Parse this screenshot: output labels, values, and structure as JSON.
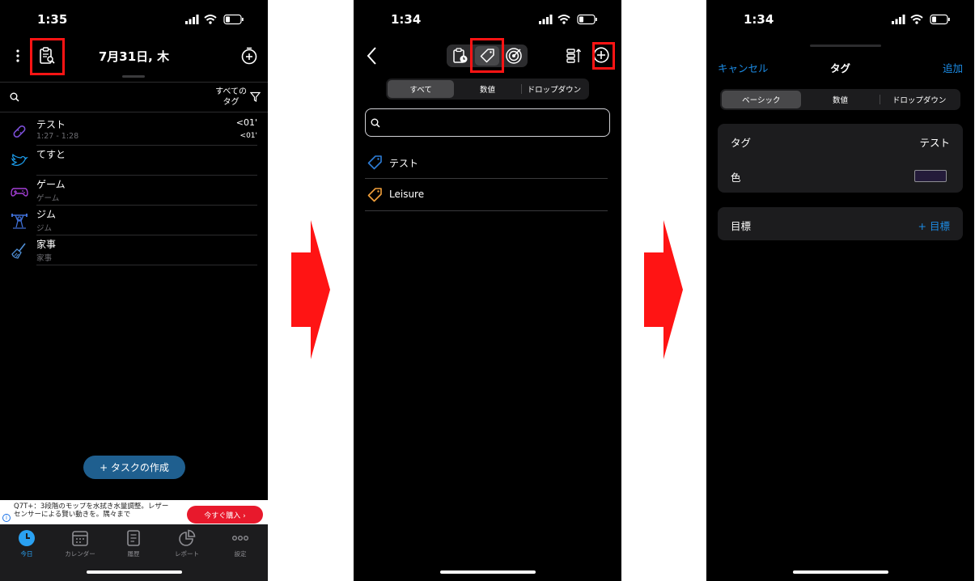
{
  "colors": {
    "arrow": "#ff1414",
    "highlight": "#ff1414",
    "accent_blue": "#1c8ce6",
    "tab_active": "#2aa1f2",
    "tag_test": "#2e7dd7",
    "tag_leisure": "#f2a03b",
    "tag_swatch": "#241b3a",
    "create_button": "#1f5f8f",
    "ad_button": "#e8192c"
  },
  "screen1": {
    "status_time": "1:35",
    "date_title": "7月31日, 木",
    "filter_label_line1": "すべての",
    "filter_label_line2": "タグ",
    "tasks": [
      {
        "name": "テスト",
        "sub": "1:27 - 1:28",
        "duration": "<01'",
        "duration2": "<01'",
        "icon": "bandage-icon",
        "color": "#7b4fd6"
      },
      {
        "name": "てすと",
        "sub": "",
        "duration": "",
        "duration2": "",
        "icon": "bird-icon",
        "color": "#1da1f2"
      },
      {
        "name": "ゲーム",
        "sub": "ゲーム",
        "duration": "",
        "duration2": "",
        "icon": "gamepad-icon",
        "color": "#a43fd6"
      },
      {
        "name": "ジム",
        "sub": "ジム",
        "duration": "",
        "duration2": "",
        "icon": "weightlifting-icon",
        "color": "#3f6fd6"
      },
      {
        "name": "家事",
        "sub": "家事",
        "duration": "",
        "duration2": "",
        "icon": "broom-icon",
        "color": "#4f8fd6"
      }
    ],
    "create_button": "+ タスクの作成",
    "ad_text": "Q7T+：3段階のモップを水拭き水量調整。レザーセンサーによる賢い動きを。隅々まで",
    "ad_button": "今すぐ購入 ›",
    "tabs": [
      {
        "label": "今日",
        "icon": "clock-icon",
        "active": true
      },
      {
        "label": "カレンダー",
        "icon": "calendar-icon",
        "active": false
      },
      {
        "label": "履歴",
        "icon": "document-icon",
        "active": false
      },
      {
        "label": "レポート",
        "icon": "pie-chart-icon",
        "active": false
      },
      {
        "label": "設定",
        "icon": "more-dots-icon",
        "active": false
      }
    ]
  },
  "screen2": {
    "status_time": "1:34",
    "segments": [
      "すべて",
      "数値",
      "ドロップダウン"
    ],
    "selected_segment": "すべて",
    "search_placeholder": "",
    "tags": [
      {
        "label": "テスト",
        "color": "#2e7dd7"
      },
      {
        "label": "Leisure",
        "color": "#f2a03b"
      }
    ]
  },
  "screen3": {
    "status_time": "1:34",
    "cancel": "キャンセル",
    "title": "タグ",
    "add": "追加",
    "segments": [
      "ベーシック",
      "数値",
      "ドロップダウン"
    ],
    "selected_segment": "ベーシック",
    "tag_label": "タグ",
    "tag_value": "テスト",
    "color_label": "色",
    "goal_label": "目標",
    "goal_action": "+ 目標"
  }
}
